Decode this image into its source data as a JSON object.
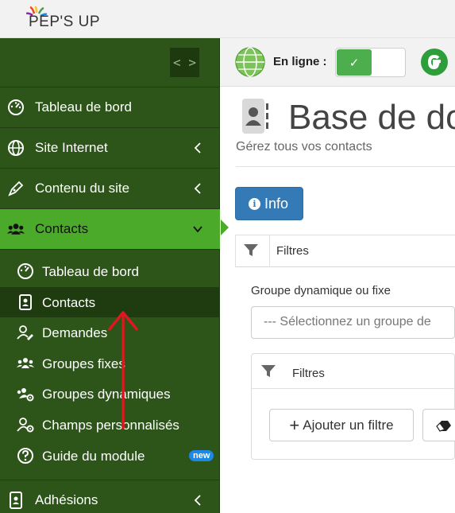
{
  "brand": {
    "logo_text": "PEP'S UP"
  },
  "sidebar": {
    "toggle_glyph": "< >",
    "items": [
      {
        "label": "Tableau de bord",
        "icon": "dashboard-icon"
      },
      {
        "label": "Site Internet",
        "icon": "globe-icon"
      },
      {
        "label": "Contenu du site",
        "icon": "pen-icon"
      },
      {
        "label": "Contacts",
        "icon": "users-icon"
      }
    ],
    "contacts_sub": [
      {
        "label": "Tableau de bord",
        "icon": "dashboard-icon"
      },
      {
        "label": "Contacts",
        "icon": "contact-card-icon"
      },
      {
        "label": "Demandes",
        "icon": "user-edit-icon"
      },
      {
        "label": "Groupes fixes",
        "icon": "users-group-icon"
      },
      {
        "label": "Groupes dynamiques",
        "icon": "users-gear-icon"
      },
      {
        "label": "Champs personnalisés",
        "icon": "user-gear-icon"
      },
      {
        "label": "Guide du module",
        "icon": "question-circle-icon",
        "badge": "new"
      }
    ],
    "bottom_item": {
      "label": "Adhésions",
      "icon": "id-badge-icon"
    }
  },
  "header": {
    "online_label": "En ligne :",
    "toggle_state": "on",
    "toggle_check": "✓"
  },
  "main": {
    "title": "Base de do",
    "subtitle": "Gérez tous vos contacts",
    "info_button": "Info",
    "info_glyph": "i",
    "filters_label": "Filtres",
    "group_label": "Groupe dynamique ou fixe",
    "group_placeholder": "--- Sélectionnez un groupe de",
    "inner_filters_label": "Filtres",
    "add_filter_plus": "+",
    "add_filter_label": "Ajouter un filtre"
  },
  "colors": {
    "sidebar_bg": "#2d5419",
    "active_green": "#4caa2b",
    "primary_blue": "#337ab7",
    "annotation_red": "#e0171e"
  }
}
